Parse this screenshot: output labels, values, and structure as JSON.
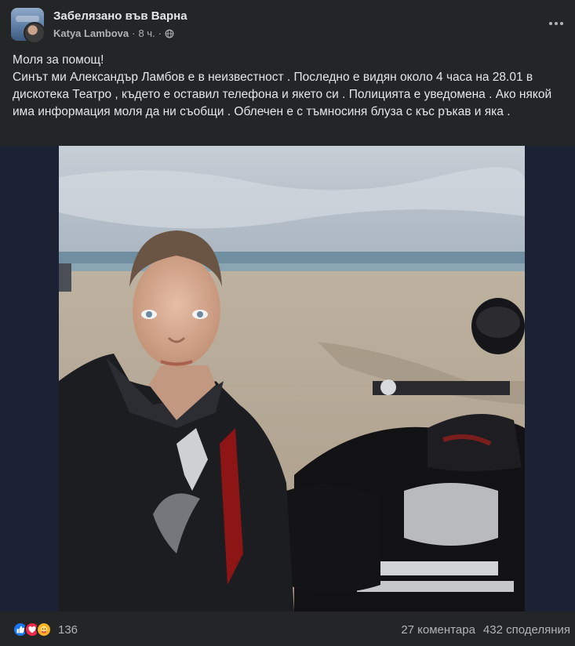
{
  "post": {
    "group_name": "Забелязано във Варна",
    "author": "Katya Lambova",
    "separator": "·",
    "time": "8 ч.",
    "privacy_icon": "globe-icon",
    "more_icon": "more-horizontal-icon",
    "text_lines": [
      "Моля за помощ!",
      "Синът ми Александър Ламбов е в неизвестност . Последно е видян около 4 часа на 28.01 в дискотека Театро , където е оставил телефона и якето си . Полицията е уведомена . Ако някой има информация моля да ни съобщи . Облечен е с тъмносиня блуза с къс ръкав и яка ."
    ]
  },
  "photo": {
    "description_icon": "photo-selfie-motorcycle-beach"
  },
  "footer": {
    "reaction_icons": [
      "like-icon",
      "love-icon",
      "care-icon"
    ],
    "reaction_count": "136",
    "comments": "27 коментара",
    "shares": "432 споделяния"
  },
  "colors": {
    "background": "#242526",
    "text_primary": "#e4e6eb",
    "text_secondary": "#b0b3b8",
    "like_blue": "#1877f2",
    "love_red": "#f0284a",
    "care_yellow": "#f7b125",
    "media_bg": "#1c2233"
  }
}
